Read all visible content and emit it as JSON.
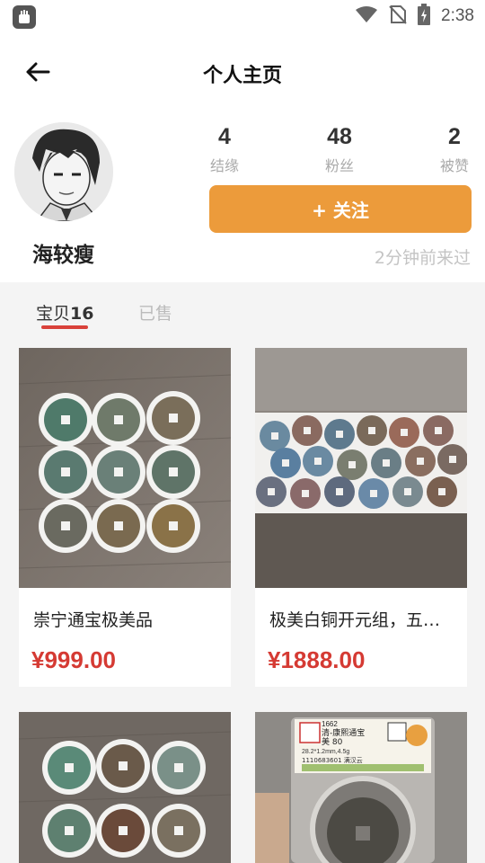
{
  "status_bar": {
    "time": "2:38"
  },
  "header": {
    "title": "个人主页"
  },
  "profile": {
    "nickname": "海较瘦",
    "stats": [
      {
        "value": "4",
        "label": "结缘"
      },
      {
        "value": "48",
        "label": "粉丝"
      },
      {
        "value": "2",
        "label": "被赞"
      }
    ],
    "follow_label": "+ 关注",
    "last_seen": "2分钟前来过"
  },
  "tabs": {
    "items_label": "宝贝",
    "items_count": "16",
    "sold_label": "已售"
  },
  "products": [
    {
      "title": "崇宁通宝极美品",
      "price": "¥999.00"
    },
    {
      "title": "极美白铜开元组，五…",
      "price": "¥1888.00"
    },
    {
      "title": "",
      "price": ""
    },
    {
      "title": "",
      "price": ""
    }
  ],
  "slab_label": {
    "grade_line1": "1662",
    "grade_line2": "清-康熙通宝",
    "grade_line3": "美 80",
    "grade_line4": "28.2*1.2mm,4.5g",
    "grade_line5": "1110683601 满汉云"
  },
  "colors": {
    "accent": "#ec9b3b",
    "price": "#d53a33",
    "tab_indicator": "#d9413a"
  }
}
